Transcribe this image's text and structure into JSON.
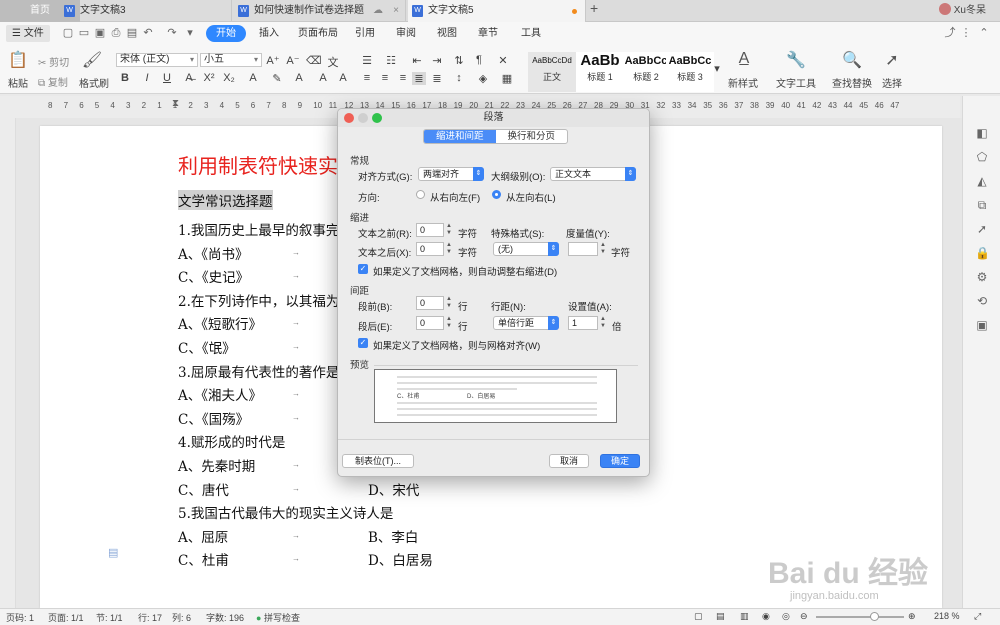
{
  "tabs": {
    "home": "首页",
    "doc1": "文字文稿3",
    "doc2": "如何快速制作试卷选择题",
    "doc3": "文字文稿5",
    "add": "+",
    "user": "Xu冬呆"
  },
  "menu": {
    "file": "文件",
    "items": [
      "开始",
      "插入",
      "页面布局",
      "引用",
      "审阅",
      "视图",
      "章节",
      "工具"
    ]
  },
  "ribbon": {
    "paste": "粘贴",
    "cut": "剪切",
    "copy": "复制",
    "format_painter": "格式刷",
    "font_name": "宋体 (正文)",
    "font_size": "小五",
    "bold": "B",
    "italic": "I",
    "underline": "U",
    "styles": [
      {
        "sample": "AaBbCcDd",
        "label": "正文"
      },
      {
        "sample": "AaBb",
        "label": "标题 1"
      },
      {
        "sample": "AaBbCc",
        "label": "标题 2"
      },
      {
        "sample": "AaBbCc",
        "label": "标题 3"
      }
    ],
    "new_style": "新样式",
    "text_tools": "文字工具",
    "find_replace": "查找替换",
    "select": "选择"
  },
  "ruler_ticks": [
    "8",
    "7",
    "6",
    "5",
    "4",
    "3",
    "2",
    "1",
    "1",
    "2",
    "3",
    "4",
    "5",
    "6",
    "7",
    "8",
    "9",
    "10",
    "11",
    "12",
    "13",
    "14",
    "15",
    "16",
    "17",
    "18",
    "19",
    "20",
    "21",
    "22",
    "23",
    "24",
    "25",
    "26",
    "27",
    "28",
    "29",
    "30",
    "31",
    "32",
    "33",
    "34",
    "35",
    "36",
    "37",
    "38",
    "39",
    "40",
    "41",
    "42",
    "43",
    "44",
    "45",
    "46",
    "47"
  ],
  "document": {
    "title": "利用制表符快速实",
    "subtitle": "文学常识选择题",
    "lines": [
      {
        "a": "1.我国历史上最早的叙事完",
        "b": ""
      },
      {
        "a": "A、《尚书》",
        "b": ""
      },
      {
        "a": "C、《史记》",
        "b": ""
      },
      {
        "a": "2.在下列诗作中，以其福为",
        "b": ""
      },
      {
        "a": "A、《短歌行》",
        "b": ""
      },
      {
        "a": "C、《氓》",
        "b": ""
      },
      {
        "a": "3.屈原最有代表性的著作是",
        "b": ""
      },
      {
        "a": "A、《湘夫人》",
        "b": ""
      },
      {
        "a": "C、《国殇》",
        "b": ""
      },
      {
        "a": "4.赋形成的时代是",
        "b": ""
      },
      {
        "a": "A、先秦时期",
        "b": ""
      },
      {
        "a": "C、唐代",
        "b": "D、宋代"
      },
      {
        "a": "5.我国古代最伟大的现实主义诗人是",
        "b": ""
      },
      {
        "a": "A、屈原",
        "b": "B、李白"
      },
      {
        "a": "C、杜甫",
        "b": "D、白居易"
      }
    ]
  },
  "dialog": {
    "title": "段落",
    "tab_indent": "缩进和间距",
    "tab_breaks": "换行和分页",
    "sec_general": "常规",
    "align_label": "对齐方式(G):",
    "align_value": "两端对齐",
    "outline_label": "大纲级别(O):",
    "outline_value": "正文文本",
    "direction_label": "方向:",
    "rtl": "从右向左(F)",
    "ltr": "从左向右(L)",
    "sec_indent": "缩进",
    "before_text_label": "文本之前(R):",
    "before_text_value": "0",
    "after_text_label": "文本之后(X):",
    "after_text_value": "0",
    "unit_char": "字符",
    "special_label": "特殊格式(S):",
    "special_value": "(无)",
    "measure_label": "度量值(Y):",
    "auto_indent_check": "如果定义了文档网格，则自动调整右缩进(D)",
    "sec_spacing": "间距",
    "space_before_label": "段前(B):",
    "space_before_value": "0",
    "space_after_label": "段后(E):",
    "space_after_value": "0",
    "unit_line": "行",
    "line_spacing_label": "行距(N):",
    "line_spacing_value": "单倍行距",
    "setting_label": "设置值(A):",
    "setting_value": "1",
    "unit_times": "倍",
    "grid_check": "如果定义了文档网格，则与网格对齐(W)",
    "sec_preview": "预览",
    "preview_c": "C、杜甫",
    "preview_d": "D、白居易",
    "tabs_button": "制表位(T)...",
    "cancel_button": "取消",
    "ok_button": "确定"
  },
  "status": {
    "page_code": "页码: 1",
    "pages": "页面: 1/1",
    "section": "节: 1/1",
    "row": "行: 17",
    "col": "列: 6",
    "words": "字数: 196",
    "spell": "拼写检查",
    "zoom": "218 %"
  },
  "watermark": {
    "main": "Bai du 经验",
    "sub": "jingyan.baidu.com"
  },
  "colors": {
    "accent": "#2f88ff",
    "title_red": "#e8231e"
  }
}
